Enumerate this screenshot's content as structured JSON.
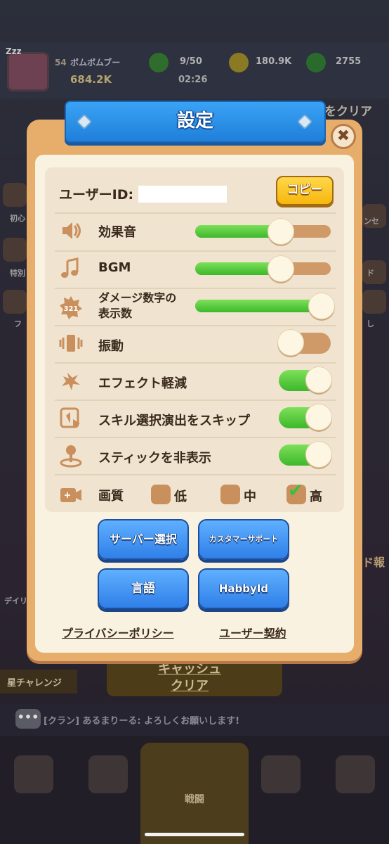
{
  "background": {
    "zzz": "Zzz",
    "level": "54",
    "player_name": "ボムボムブー",
    "power": "684.2K",
    "stamina": "9/50",
    "coins": "180.9K",
    "gems": "2755",
    "timer": "02:26",
    "cash_clear": "キャッシュ\nクリア",
    "star_challenge": "星チャレンジ",
    "chat_icon": "•••",
    "chat_message": "[クラン] あるまりーる: よろしくお願いします!",
    "nav_battle": "戦闘",
    "side_left_labels": [
      "初心",
      "特別",
      "フ",
      "デイリ"
    ],
    "side_right_labels": [
      "ンセ",
      "ド",
      "し",
      "ド報"
    ],
    "top_right_text": "をクリア"
  },
  "modal": {
    "title": "設定",
    "close_icon": "✖",
    "user_id_label": "ユーザーID:",
    "user_id_value": "",
    "copy_button": "コピー",
    "settings": [
      {
        "key": "sound_effect",
        "label": "効果音",
        "icon": "speaker-icon",
        "type": "slider",
        "value": 0.63
      },
      {
        "key": "bgm",
        "label": "BGM",
        "icon": "music-note-icon",
        "type": "slider",
        "value": 0.63
      },
      {
        "key": "damage_numbers",
        "label": "ダメージ数字の\n表示数",
        "icon": "damage-badge-icon",
        "badge": "321",
        "type": "slider",
        "value": 1.0
      },
      {
        "key": "vibration",
        "label": "振動",
        "icon": "vibration-icon",
        "type": "toggle",
        "value": false
      },
      {
        "key": "effect_reduce",
        "label": "エフェクト軽減",
        "icon": "effect-icon",
        "type": "toggle",
        "value": true
      },
      {
        "key": "skip_skill_anim",
        "label": "スキル選択演出をスキップ",
        "icon": "skip-icon",
        "type": "toggle",
        "value": true
      },
      {
        "key": "hide_stick",
        "label": "スティックを非表示",
        "icon": "joystick-icon",
        "type": "toggle",
        "value": true
      }
    ],
    "quality": {
      "label": "画質",
      "icon": "camera-icon",
      "options": [
        "低",
        "中",
        "高"
      ],
      "selected": "高"
    },
    "buttons": {
      "server_select": "サーバー選択",
      "customer_support": "カスタマーサポート",
      "language": "言語",
      "habby_id": "HabbyId"
    },
    "links": {
      "privacy_policy": "プライバシーポリシー",
      "user_agreement": "ユーザー契約"
    }
  },
  "colors": {
    "accent_green": "#3cb82a",
    "track": "#cf9a68",
    "button_blue": "#2f7fe8",
    "copy_yellow": "#f6b70d",
    "frame": "#e7ad6b"
  }
}
